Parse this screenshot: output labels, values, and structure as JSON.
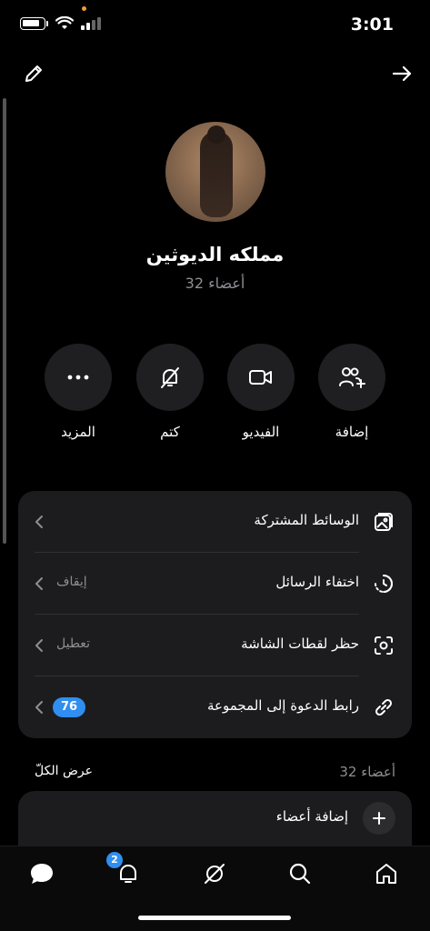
{
  "status_bar": {
    "time": "3:01"
  },
  "group": {
    "name": "مملكه الديوثين",
    "members_label": "32 أعضاء"
  },
  "actions": [
    {
      "id": "add",
      "label": "إضافة",
      "icon": "add-user-icon"
    },
    {
      "id": "video",
      "label": "الفيديو",
      "icon": "video-icon"
    },
    {
      "id": "mute",
      "label": "كتم",
      "icon": "bell-off-icon"
    },
    {
      "id": "more",
      "label": "المزيد",
      "icon": "more-icon"
    }
  ],
  "settings": {
    "shared_media": {
      "title": "الوسائط المشتركة",
      "icon": "media-icon"
    },
    "disappearing": {
      "title": "اختفاء الرسائل",
      "value": "إيقاف",
      "icon": "timer-icon"
    },
    "screenshot": {
      "title": "حظر لقطات الشاشة",
      "value": "تعطيل",
      "icon": "screenshot-icon"
    },
    "invite_link": {
      "title": "رابط الدعوة إلى المجموعة",
      "badge": "76",
      "icon": "link-icon"
    }
  },
  "members": {
    "count_label": "32 أعضاء",
    "view_all": "عرض الكلّ",
    "add_members": "إضافة أعضاء"
  },
  "tab_bar": {
    "notification_count": "2"
  },
  "colors": {
    "accent": "#2f8ef0",
    "card": "#1c1c1e",
    "muted": "#8e8e93"
  }
}
